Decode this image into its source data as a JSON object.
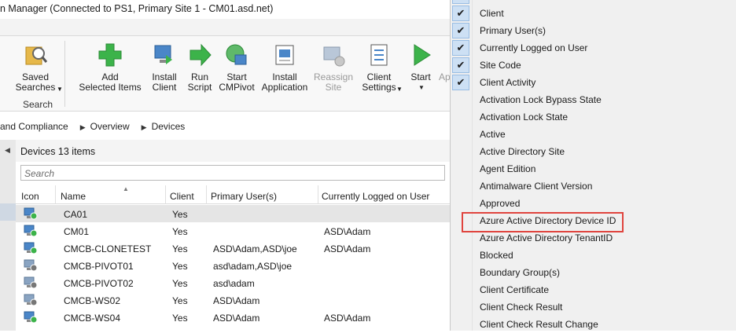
{
  "window": {
    "title": "n Manager (Connected to PS1, Primary Site 1 - CM01.asd.net)"
  },
  "ribbon": {
    "saved_searches": "Saved\nSearches",
    "search_group": "Search",
    "add_selected_items": "Add\nSelected Items",
    "install_client": "Install\nClient",
    "run_script": "Run\nScript",
    "start_cmpivot": "Start\nCMPivot",
    "install_application": "Install\nApplication",
    "reassign_site": "Reassign\nSite",
    "client_settings": "Client\nSettings",
    "start": "Start",
    "truncated": "Ap"
  },
  "breadcrumb": [
    "and Compliance",
    "Overview",
    "Devices"
  ],
  "panel": {
    "header": "Devices 13 items",
    "search_placeholder": "Search"
  },
  "grid": {
    "columns": [
      "Icon",
      "Name",
      "Client",
      "Primary User(s)",
      "Currently Logged on User"
    ],
    "rows": [
      {
        "name": "CA01",
        "client": "Yes",
        "primary": "",
        "logged": "",
        "selected": true,
        "icon": "device-online-icon"
      },
      {
        "name": "CM01",
        "client": "Yes",
        "primary": "",
        "logged": "ASD\\Adam",
        "icon": "device-online-icon"
      },
      {
        "name": "CMCB-CLONETEST",
        "client": "Yes",
        "primary": "ASD\\Adam,ASD\\joe",
        "logged": "ASD\\Adam",
        "icon": "device-online-icon"
      },
      {
        "name": "CMCB-PIVOT01",
        "client": "Yes",
        "primary": "asd\\adam,ASD\\joe",
        "logged": "",
        "icon": "device-offline-icon"
      },
      {
        "name": "CMCB-PIVOT02",
        "client": "Yes",
        "primary": "asd\\adam",
        "logged": "",
        "icon": "device-offline-icon"
      },
      {
        "name": "CMCB-WS02",
        "client": "Yes",
        "primary": "ASD\\Adam",
        "logged": "",
        "icon": "device-offline-icon"
      },
      {
        "name": "CMCB-WS04",
        "client": "Yes",
        "primary": "ASD\\Adam",
        "logged": "ASD\\Adam",
        "icon": "device-online-icon"
      }
    ]
  },
  "column_menu": {
    "items": [
      {
        "label": "Client",
        "checked": true
      },
      {
        "label": "Primary User(s)",
        "checked": true
      },
      {
        "label": "Currently Logged on User",
        "checked": true
      },
      {
        "label": "Site Code",
        "checked": true
      },
      {
        "label": "Client Activity",
        "checked": true
      },
      {
        "label": "Activation Lock Bypass State",
        "checked": false
      },
      {
        "label": "Activation Lock State",
        "checked": false
      },
      {
        "label": "Active",
        "checked": false
      },
      {
        "label": "Active Directory Site",
        "checked": false
      },
      {
        "label": "Agent Edition",
        "checked": false
      },
      {
        "label": "Antimalware Client Version",
        "checked": false
      },
      {
        "label": "Approved",
        "checked": false
      },
      {
        "label": "Azure Active Directory Device ID",
        "checked": false
      },
      {
        "label": "Azure Active Directory TenantID",
        "checked": false
      },
      {
        "label": "Blocked",
        "checked": false
      },
      {
        "label": "Boundary Group(s)",
        "checked": false
      },
      {
        "label": "Client Certificate",
        "checked": false
      },
      {
        "label": "Client Check Result",
        "checked": false
      },
      {
        "label": "Client Check Result Change",
        "checked": false
      }
    ],
    "highlighted": "Azure Active Directory Device ID"
  },
  "colors": {
    "accent": "#cde0f4",
    "highlight_border": "#e0443e",
    "green_icon": "#3cb34a"
  }
}
